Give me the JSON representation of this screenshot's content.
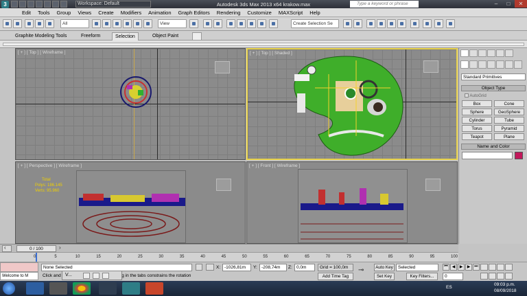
{
  "titlebar": {
    "logo": "3",
    "workspace": "Workspace: Default",
    "title": "Autodesk 3ds Max  2013 x64       krakow.max",
    "search_placeholder": "Type a keyword or phrase",
    "minimize": "–",
    "maximize": "□",
    "close": "✕"
  },
  "menu": [
    "Edit",
    "Tools",
    "Group",
    "Views",
    "Create",
    "Modifiers",
    "Animation",
    "Graph Editors",
    "Rendering",
    "Customize",
    "MAXScript",
    "Help"
  ],
  "toolbar": {
    "filter": "All",
    "ref_coord": "View",
    "selection_set": "Create Selection Se"
  },
  "ribbon": {
    "tabs": [
      "Graphite Modeling Tools",
      "Freeform",
      "Selection",
      "Object Paint"
    ],
    "active_tab": "Selection"
  },
  "viewports": {
    "top_left": "[ + ] [ Top ] [ Wireframe ]",
    "top_right": "[ + ] [ Top ] [ Shaded ]",
    "bottom_left": "[ + ] [ Perspective ] [ Wireframe ]",
    "bottom_right": "[ + ] [ Front ] [ Wireframe ]",
    "stats": {
      "total_label": "Total",
      "polys": "Polys:  186.145",
      "verts": "Verts:   95.960"
    }
  },
  "command_panel": {
    "category": "Standard Primitives",
    "object_type_title": "Object Type",
    "autogrid": "AutoGrid",
    "buttons": [
      "Box",
      "Cone",
      "Sphere",
      "GeoSphere",
      "Cylinder",
      "Tube",
      "Torus",
      "Pyramid",
      "Teapot",
      "Plane"
    ],
    "name_color_title": "Name and Color",
    "color": "#c2185b"
  },
  "timeline": {
    "frame": "0 / 100",
    "ticks": [
      "0",
      "5",
      "10",
      "15",
      "20",
      "25",
      "30",
      "35",
      "40",
      "45",
      "50",
      "55",
      "60",
      "65",
      "70",
      "75",
      "80",
      "85",
      "90",
      "95",
      "100"
    ]
  },
  "status": {
    "selection": "None Selected",
    "prompt": "Click and drag to rotate the view.  Clicking in the tabs constrains the rotation",
    "x_label": "X:",
    "x_value": "-1026,81m",
    "y_label": "Y:",
    "y_value": "-208,74m",
    "z_label": "Z:",
    "z_value": "0,0m",
    "grid": "Grid = 100,0m",
    "add_time_tag": "Add Time Tag",
    "auto_key": "Auto Key",
    "set_key": "Set Key",
    "selected": "Selected",
    "key_filters": "Key Filters...",
    "frame_field": "0",
    "listener": "Welcome to M",
    "popup": "V..."
  },
  "taskbar": {
    "lang": "ES",
    "time": "09:03 p.m.",
    "date": "08/09/2018"
  }
}
